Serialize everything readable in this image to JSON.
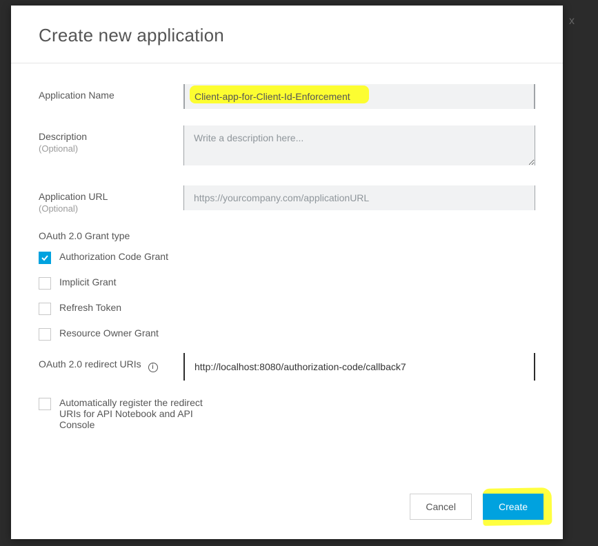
{
  "dialog": {
    "title": "Create new application"
  },
  "fields": {
    "appName": {
      "label": "Application Name",
      "value": "Client-app-for-Client-Id-Enforcement"
    },
    "description": {
      "label": "Description",
      "optional": "(Optional)",
      "placeholder": "Write a description here..."
    },
    "appUrl": {
      "label": "Application URL",
      "optional": "(Optional)",
      "placeholder": "https://yourcompany.com/applicationURL"
    },
    "grantTypeHeading": "OAuth 2.0 Grant type",
    "grants": {
      "authCode": {
        "label": "Authorization Code Grant",
        "checked": true
      },
      "implicit": {
        "label": "Implicit Grant",
        "checked": false
      },
      "refresh": {
        "label": "Refresh Token",
        "checked": false
      },
      "resourceOwner": {
        "label": "Resource Owner Grant",
        "checked": false
      }
    },
    "redirect": {
      "label": "OAuth 2.0 redirect URIs",
      "value": "http://localhost:8080/authorization-code/callback7"
    },
    "autoRegister": {
      "label": "Automatically register the redirect URIs for API Notebook and API Console",
      "checked": false
    }
  },
  "footer": {
    "cancel": "Cancel",
    "create": "Create"
  },
  "bg": {
    "close_x": "x"
  }
}
